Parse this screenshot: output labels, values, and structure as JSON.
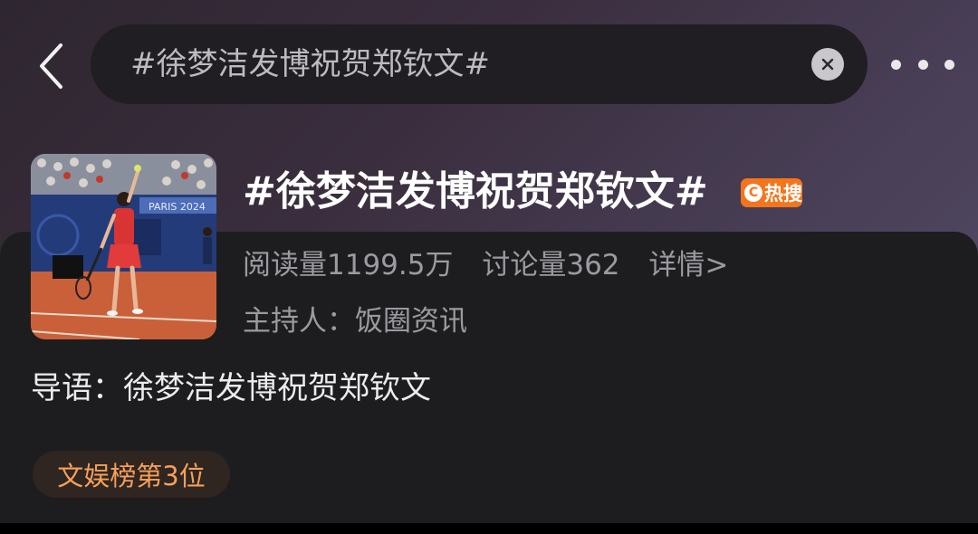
{
  "search": {
    "query": "#徐梦洁发博祝贺郑钦文#"
  },
  "topic": {
    "title": "#徐梦洁发博祝贺郑钦文#",
    "hot_badge": "热搜",
    "reads": "阅读量1199.5万",
    "discussions": "讨论量362",
    "details_link": "详情>",
    "host": "主持人：饭圈资讯",
    "intro": "导语：徐梦洁发博祝贺郑钦文",
    "rank": "文娱榜第3位",
    "thumbnail": {
      "scoreboard_text": "PARIS 2024"
    }
  },
  "colors": {
    "accent_orange": "#f5751c",
    "rank_text": "#f5a05a",
    "card_bg": "#1d1d1f",
    "search_bg": "#201e22"
  },
  "icons": {
    "back": "chevron-left-icon",
    "clear": "close-icon",
    "more": "more-horizontal-icon"
  }
}
